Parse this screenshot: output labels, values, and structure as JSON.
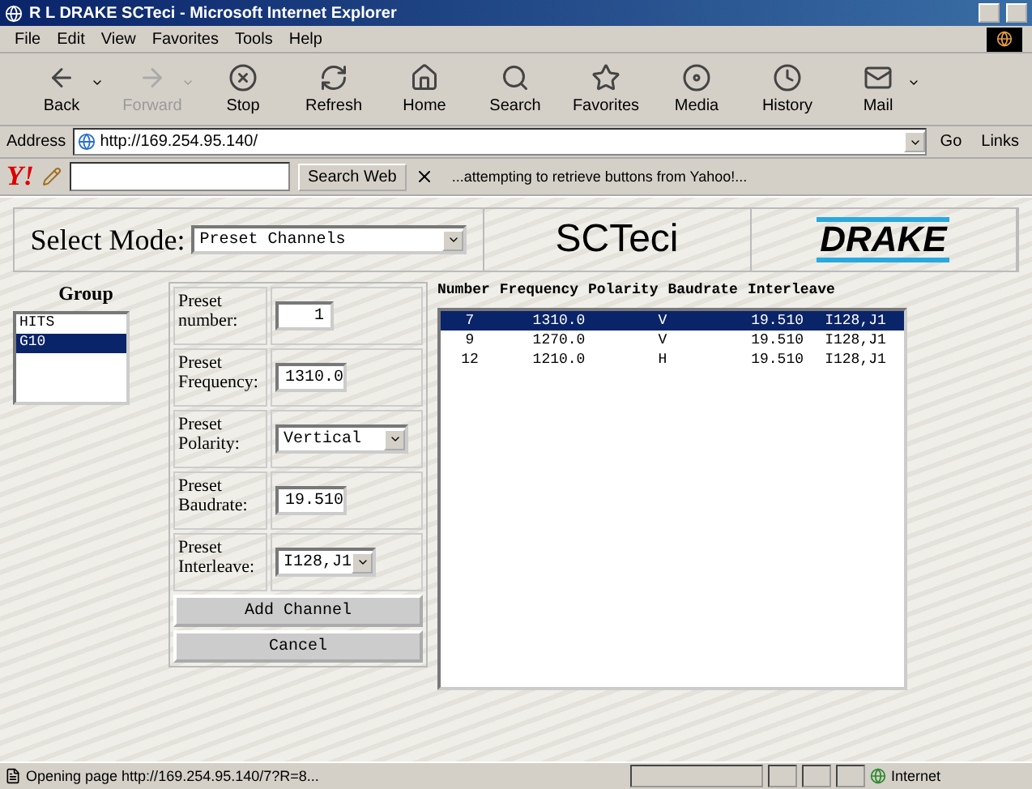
{
  "window": {
    "title": "R L DRAKE SCTeci - Microsoft Internet Explorer"
  },
  "menu": [
    "File",
    "Edit",
    "View",
    "Favorites",
    "Tools",
    "Help"
  ],
  "toolbar": [
    {
      "label": "Back",
      "disabled": false,
      "dropdown": true
    },
    {
      "label": "Forward",
      "disabled": true,
      "dropdown": true
    },
    {
      "label": "Stop",
      "disabled": false,
      "dropdown": false
    },
    {
      "label": "Refresh",
      "disabled": false,
      "dropdown": false
    },
    {
      "label": "Home",
      "disabled": false,
      "dropdown": false
    },
    {
      "label": "Search",
      "disabled": false,
      "dropdown": false
    },
    {
      "label": "Favorites",
      "disabled": false,
      "dropdown": false
    },
    {
      "label": "Media",
      "disabled": false,
      "dropdown": false
    },
    {
      "label": "History",
      "disabled": false,
      "dropdown": false
    },
    {
      "label": "Mail",
      "disabled": false,
      "dropdown": true
    }
  ],
  "address": {
    "label": "Address",
    "value": "http://169.254.95.140/",
    "go": "Go",
    "links": "Links"
  },
  "yahoo_bar": {
    "logo": "Y!",
    "search_button": "Search Web",
    "message": "...attempting to retrieve buttons from Yahoo!..."
  },
  "page": {
    "mode_label": "Select Mode:",
    "mode_value": "Preset Channels",
    "product": "SCTeci",
    "brand": "DRAKE",
    "group": {
      "title": "Group",
      "items": [
        {
          "label": "HITS",
          "selected": false
        },
        {
          "label": "G10",
          "selected": true
        }
      ]
    },
    "form": [
      {
        "label": "Preset number:",
        "kind": "input",
        "value": "1"
      },
      {
        "label": "Preset Frequency:",
        "kind": "input",
        "value": "1310.0"
      },
      {
        "label": "Preset Polarity:",
        "kind": "select",
        "value": "Vertical"
      },
      {
        "label": "Preset Baudrate:",
        "kind": "input",
        "value": "19.510"
      },
      {
        "label": "Preset Interleave:",
        "kind": "select",
        "value": "I128,J1"
      }
    ],
    "buttons": [
      "Add Channel",
      "Cancel"
    ],
    "table": {
      "columns": [
        "Number",
        "Frequency",
        "Polarity",
        "Baudrate",
        "Interleave"
      ],
      "rows": [
        {
          "cells": [
            "7",
            "1310.0",
            "V",
            "19.510",
            "I128,J1"
          ],
          "selected": true
        },
        {
          "cells": [
            "9",
            "1270.0",
            "V",
            "19.510",
            "I128,J1"
          ],
          "selected": false
        },
        {
          "cells": [
            "12",
            "1210.0",
            "H",
            "19.510",
            "I128,J1"
          ],
          "selected": false
        }
      ]
    }
  },
  "status_bar": {
    "text": "Opening page http://169.254.95.140/7?R=8...",
    "zone": "Internet"
  }
}
